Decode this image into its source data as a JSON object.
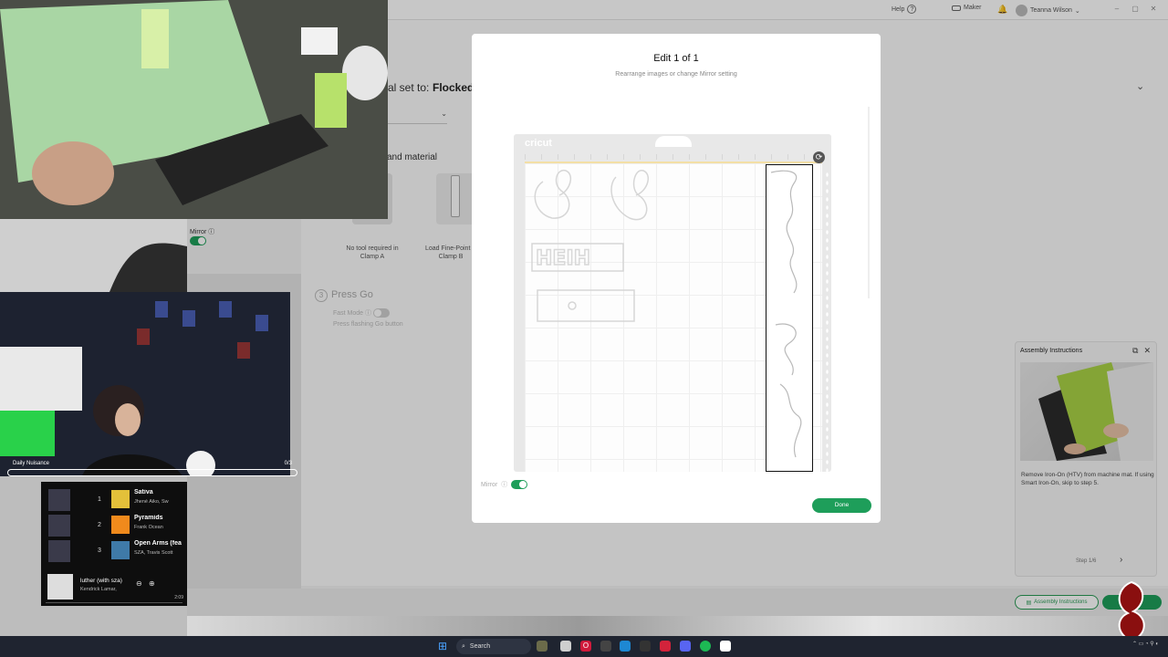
{
  "app": {
    "topbar": {
      "help_label": "Help",
      "maker_label": "Maker",
      "user_name": "Teanna Wilson"
    },
    "background": {
      "material_set_prefix": "al set to:",
      "material_set_value": "Flocked",
      "tool_heading": "and material",
      "mirror_label": "Mirror",
      "clamp_a_label": "No tool required in Clamp A",
      "clamp_b_label": "Load Fine-Point B Clamp B",
      "press_go_number": "3",
      "press_go_label": "Press Go",
      "fast_mode_label": "Fast Mode",
      "press_flashing_label": "Press flashing Go button"
    },
    "assembly": {
      "title": "Assembly Instructions",
      "text": "Remove Iron-On (HTV) from machine mat. If using Smart Iron-On, skip to step 5.",
      "step": "Step 1/6",
      "button_label": "Assembly Instructions"
    }
  },
  "modal": {
    "title": "Edit 1 of 1",
    "subtitle": "Rearrange images or change Mirror setting",
    "mat_brand": "cricut",
    "mirror_label": "Mirror",
    "done_label": "Done"
  },
  "stream": {
    "subgoal_label": "Daily Nuisance",
    "subgoal_count": "0/3",
    "songs": [
      {
        "rank": "1",
        "title": "Sativa",
        "artist": "Jhené Aiko, Sw",
        "color": "#e3c03a"
      },
      {
        "rank": "2",
        "title": "Pyramids",
        "artist": "Frank Ocean",
        "color": "#f08a1c"
      },
      {
        "rank": "3",
        "title": "Open Arms (fea",
        "artist": "SZA, Travis Scott",
        "color": "#3f7aa8"
      }
    ],
    "now_playing": {
      "title": "luther (with sza)",
      "artist": "Kendrick Lamar,",
      "time": "2:09"
    }
  },
  "taskbar": {
    "search_label": "Search"
  },
  "colors": {
    "accent_green": "#1e9e5a"
  }
}
